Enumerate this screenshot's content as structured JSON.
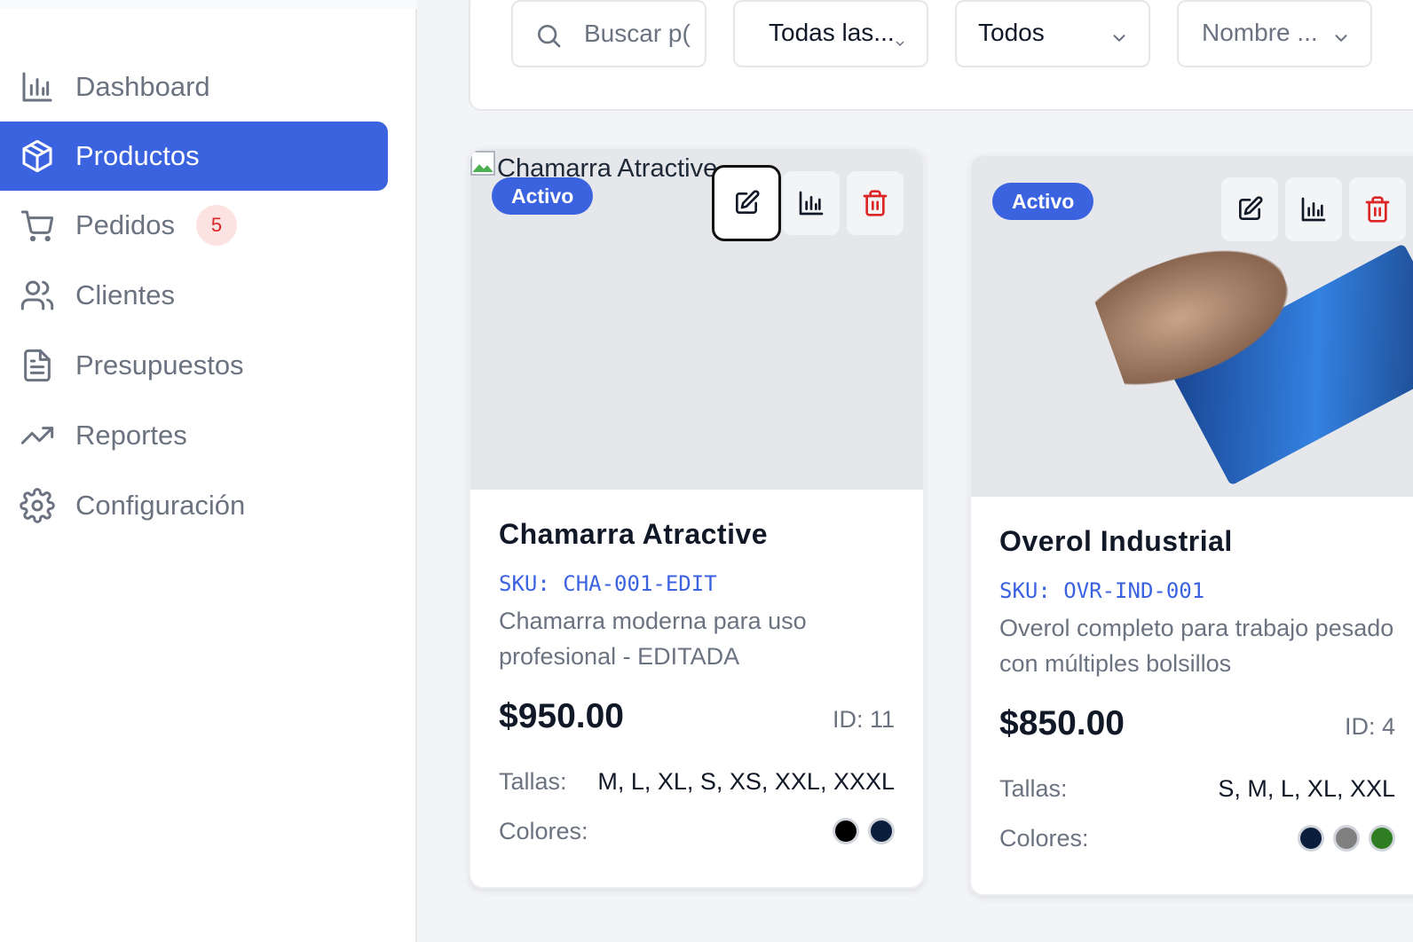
{
  "sidebar": {
    "items": [
      {
        "label": "Dashboard",
        "icon": "bar-chart-icon",
        "active": false
      },
      {
        "label": "Productos",
        "icon": "box-icon",
        "active": true
      },
      {
        "label": "Pedidos",
        "icon": "cart-icon",
        "active": false,
        "badge": "5"
      },
      {
        "label": "Clientes",
        "icon": "users-icon",
        "active": false
      },
      {
        "label": "Presupuestos",
        "icon": "document-icon",
        "active": false
      },
      {
        "label": "Reportes",
        "icon": "trending-up-icon",
        "active": false
      },
      {
        "label": "Configuración",
        "icon": "gear-icon",
        "active": false
      }
    ]
  },
  "filters": {
    "search_placeholder": "Buscar p(",
    "category_value": "Todas las...",
    "status_value": "Todos",
    "sort_value": "Nombre ..."
  },
  "products": [
    {
      "name": "Chamarra Atractive",
      "image_alt": "Chamarra Atractive",
      "status": "Activo",
      "sku": "SKU: CHA-001-EDIT",
      "description": "Chamarra moderna para uso profesional - EDITADA",
      "price": "$950.00",
      "id_label": "ID: 11",
      "sizes_label": "Tallas:",
      "sizes": "M, L, XL, S, XS, XXL, XXXL",
      "colors_label": "Colores:",
      "colors": [
        "#000000",
        "#0b1f3d"
      ]
    },
    {
      "name": "Overol Industrial",
      "status": "Activo",
      "sku": "SKU: OVR-IND-001",
      "description": "Overol completo para trabajo pesado con múltiples bolsillos",
      "price": "$850.00",
      "id_label": "ID: 4",
      "sizes_label": "Tallas:",
      "sizes": "S, M, L, XL, XXL",
      "colors_label": "Colores:",
      "colors": [
        "#0b1f3d",
        "#808080",
        "#2e7d22"
      ]
    }
  ],
  "colors": {
    "accent": "#3b63e0",
    "danger": "#dc2626",
    "muted_text": "#6b7280"
  }
}
